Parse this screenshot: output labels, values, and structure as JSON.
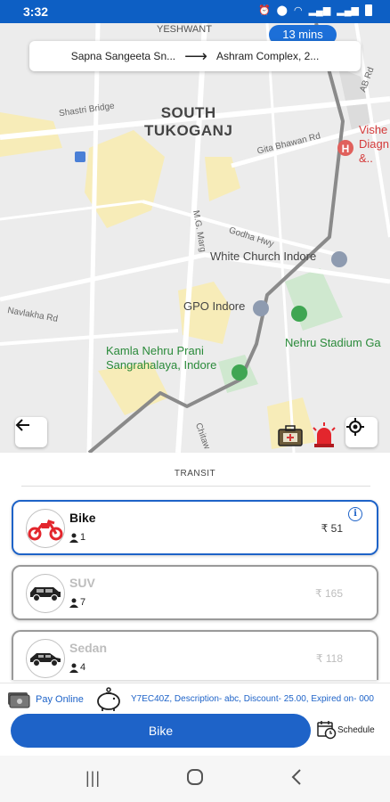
{
  "status_bar": {
    "time": "3:32"
  },
  "map": {
    "eta": "13 mins",
    "pickup": "Sapna Sangeeta Sn...",
    "drop": "Ashram Complex, 2...",
    "labels": {
      "yeshwant": "YESHWANT",
      "south_tukoganj": "SOUTH\nTUKOGANJ",
      "shastri_bridge": "Shastri Bridge",
      "gita_bhawan": "Gita Bhawan Rd",
      "godha_hwy": "Godha Hwy",
      "white_church": "White Church Indore",
      "gpo": "GPO Indore",
      "nehru_stadium": "Nehru Stadium Ga",
      "kamla_nehru": "Kamla Nehru Prani\nSangrahalaya, Indore",
      "navlakha": "Navlakha Rd",
      "visheshGlobe": "Vishe\nDiagn\n&..",
      "mg_marg": "M.G. Marg",
      "ab_rd": "AB Rd",
      "chitawad": "Chitaw"
    }
  },
  "sheet": {
    "section_title": "TRANSIT",
    "vehicles": [
      {
        "name": "Bike",
        "seats": "1",
        "price": "₹ 51",
        "color": "#e3262d"
      },
      {
        "name": "SUV",
        "seats": "7",
        "price": "₹ 165",
        "color": "#222222"
      },
      {
        "name": "Sedan",
        "seats": "4",
        "price": "₹ 118",
        "color": "#222222"
      }
    ],
    "pay_label": "Pay Online",
    "coupon_text": "Y7EC40Z, Description- abc, Discount- 25.00, Expired on- 000",
    "book_button": "Bike",
    "schedule_label": "Schedule"
  },
  "colors": {
    "primary": "#1e63c8",
    "status_bar": "#0d5fc4",
    "bike_red": "#e3262d"
  }
}
